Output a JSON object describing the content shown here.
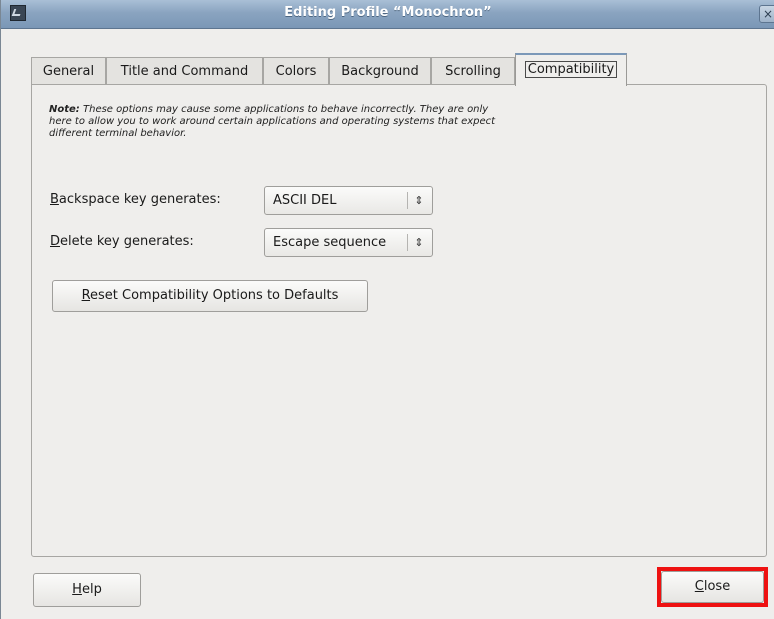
{
  "window": {
    "title": "Editing Profile “Monochron”",
    "close_glyph": "×"
  },
  "tabs": [
    {
      "label": "General"
    },
    {
      "label": "Title and Command"
    },
    {
      "label": "Colors"
    },
    {
      "label": "Background"
    },
    {
      "label": "Scrolling"
    },
    {
      "label": "Compatibility",
      "active": true
    }
  ],
  "compat": {
    "note_label": "Note:",
    "note_text": " These options may cause some applications to behave incorrectly.  They are only here to allow you to work around certain applications and operating systems that expect different terminal behavior.",
    "backspace_mnemonic": "B",
    "backspace_rest": "ackspace key generates:",
    "backspace_value": "ASCII DEL",
    "delete_mnemonic": "D",
    "delete_rest": "elete key generates:",
    "delete_value": "Escape sequence",
    "reset_mnemonic": "R",
    "reset_rest": "eset Compatibility Options to Defaults",
    "combo_arrow": "⇕"
  },
  "footer": {
    "help_mnemonic": "H",
    "help_rest": "elp",
    "close_mnemonic": "C",
    "close_rest": "lose"
  },
  "colors": {
    "titlebar": "#8aa4c0",
    "highlight": "#ee1111"
  }
}
